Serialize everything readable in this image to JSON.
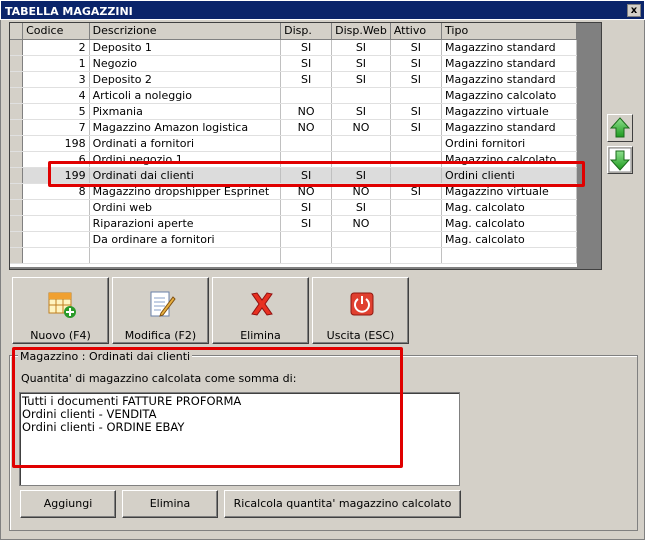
{
  "window": {
    "title": "TABELLA MAGAZZINI",
    "close_glyph": "x"
  },
  "grid": {
    "columns": [
      "Codice",
      "Descrizione",
      "Disp.",
      "Disp.Web",
      "Attivo",
      "Tipo"
    ],
    "rows": [
      [
        "2",
        "Deposito 1",
        "SI",
        "SI",
        "SI",
        "Magazzino standard"
      ],
      [
        "1",
        "Negozio",
        "SI",
        "SI",
        "SI",
        "Magazzino standard"
      ],
      [
        "3",
        "Deposito 2",
        "SI",
        "SI",
        "SI",
        "Magazzino standard"
      ],
      [
        "4",
        "Articoli a noleggio",
        "",
        "",
        "",
        "Magazzino calcolato"
      ],
      [
        "5",
        "Pixmania",
        "NO",
        "SI",
        "SI",
        "Magazzino virtuale"
      ],
      [
        "7",
        "Magazzino Amazon logistica",
        "NO",
        "NO",
        "SI",
        "Magazzino standard"
      ],
      [
        "198",
        "Ordinati a fornitori",
        "",
        "",
        "",
        "Ordini fornitori"
      ],
      [
        "6",
        "Ordini negozio 1",
        "",
        "",
        "",
        "Magazzino calcolato"
      ],
      [
        "199",
        "Ordinati dai clienti",
        "SI",
        "SI",
        "",
        "Ordini clienti"
      ],
      [
        "8",
        "Magazzino dropshipper Esprinet",
        "NO",
        "NO",
        "SI",
        "Magazzino virtuale"
      ],
      [
        "",
        "Ordini web",
        "SI",
        "SI",
        "",
        "Mag. calcolato"
      ],
      [
        "",
        "Riparazioni aperte",
        "SI",
        "NO",
        "",
        "Mag. calcolato"
      ],
      [
        "",
        "Da ordinare a fornitori",
        "",
        "",
        "",
        "Mag. calcolato"
      ]
    ],
    "selected_row": 8
  },
  "toolbar": {
    "nuovo": "Nuovo (F4)",
    "modifica": "Modifica (F2)",
    "elimina": "Elimina",
    "uscita": "Uscita (ESC)"
  },
  "detail": {
    "group_title": "Magazzino : Ordinati dai clienti",
    "subtitle": "Quantita' di magazzino calcolata come somma di:",
    "items": [
      "Tutti i documenti FATTURE PROFORMA",
      "Ordini clienti - VENDITA",
      "Ordini clienti - ORDINE EBAY"
    ]
  },
  "bottom_buttons": {
    "aggiungi": "Aggiungi",
    "elimina": "Elimina",
    "ricalcola": "Ricalcola quantita' magazzino calcolato"
  },
  "colors": {
    "highlight": "#e00000",
    "titlebar": "#0a246a",
    "arrow_green": "#3cb43c"
  },
  "icons": [
    "grid-add-icon",
    "edit-document-icon",
    "delete-x-icon",
    "power-exit-icon",
    "arrow-up-icon",
    "arrow-down-icon"
  ]
}
